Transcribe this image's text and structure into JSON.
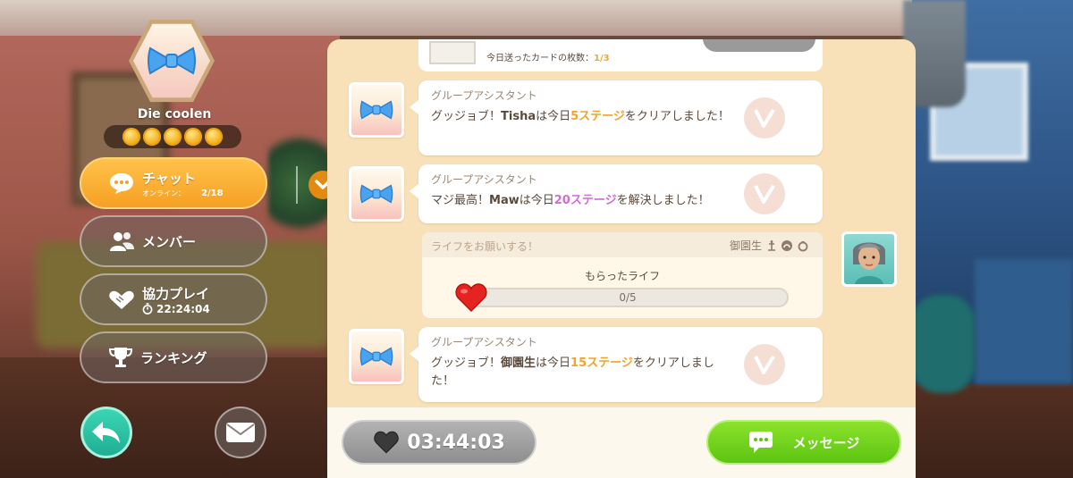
{
  "team": {
    "name": "Die coolen",
    "stars": 5
  },
  "sidebar": {
    "chat": {
      "label": "チャット",
      "online_label": "オンライン：",
      "online_count": "2/18"
    },
    "members": {
      "label": "メンバー"
    },
    "coop": {
      "label": "協力プレイ",
      "timer": "22:24:04"
    },
    "ranking": {
      "label": "ランキング"
    }
  },
  "chat": {
    "top_partial": {
      "card_label": "今日送ったカードの枚数：",
      "card_count": "1/3"
    },
    "messages": [
      {
        "sender": "グループアシスタント",
        "parts": [
          "グッジョブ！",
          "Tisha",
          "は今日",
          "5ステージ",
          "をクリアしました！"
        ]
      },
      {
        "sender": "グループアシスタント",
        "parts": [
          "マジ最高！",
          "Maw",
          "は今日",
          "20ステージ",
          "を解決しました！"
        ]
      },
      {
        "sender": "グループアシスタント",
        "parts": [
          "グッジョブ！",
          "御園生",
          "は今日",
          "15ステージ",
          "をクリアしました！"
        ]
      }
    ],
    "life_request": {
      "title": "ライフをお願いする！",
      "user": "御園生",
      "received_label": "もらったライフ",
      "progress_text": "0/5",
      "progress_value": 0
    }
  },
  "footer": {
    "timer": "03:44:03",
    "send_label": "メッセージ"
  },
  "colors": {
    "accent_orange": "#f6a024",
    "send_green": "#5cc411",
    "highlight_orange": "#f3a32d",
    "highlight_purple": "#d06cd6"
  }
}
